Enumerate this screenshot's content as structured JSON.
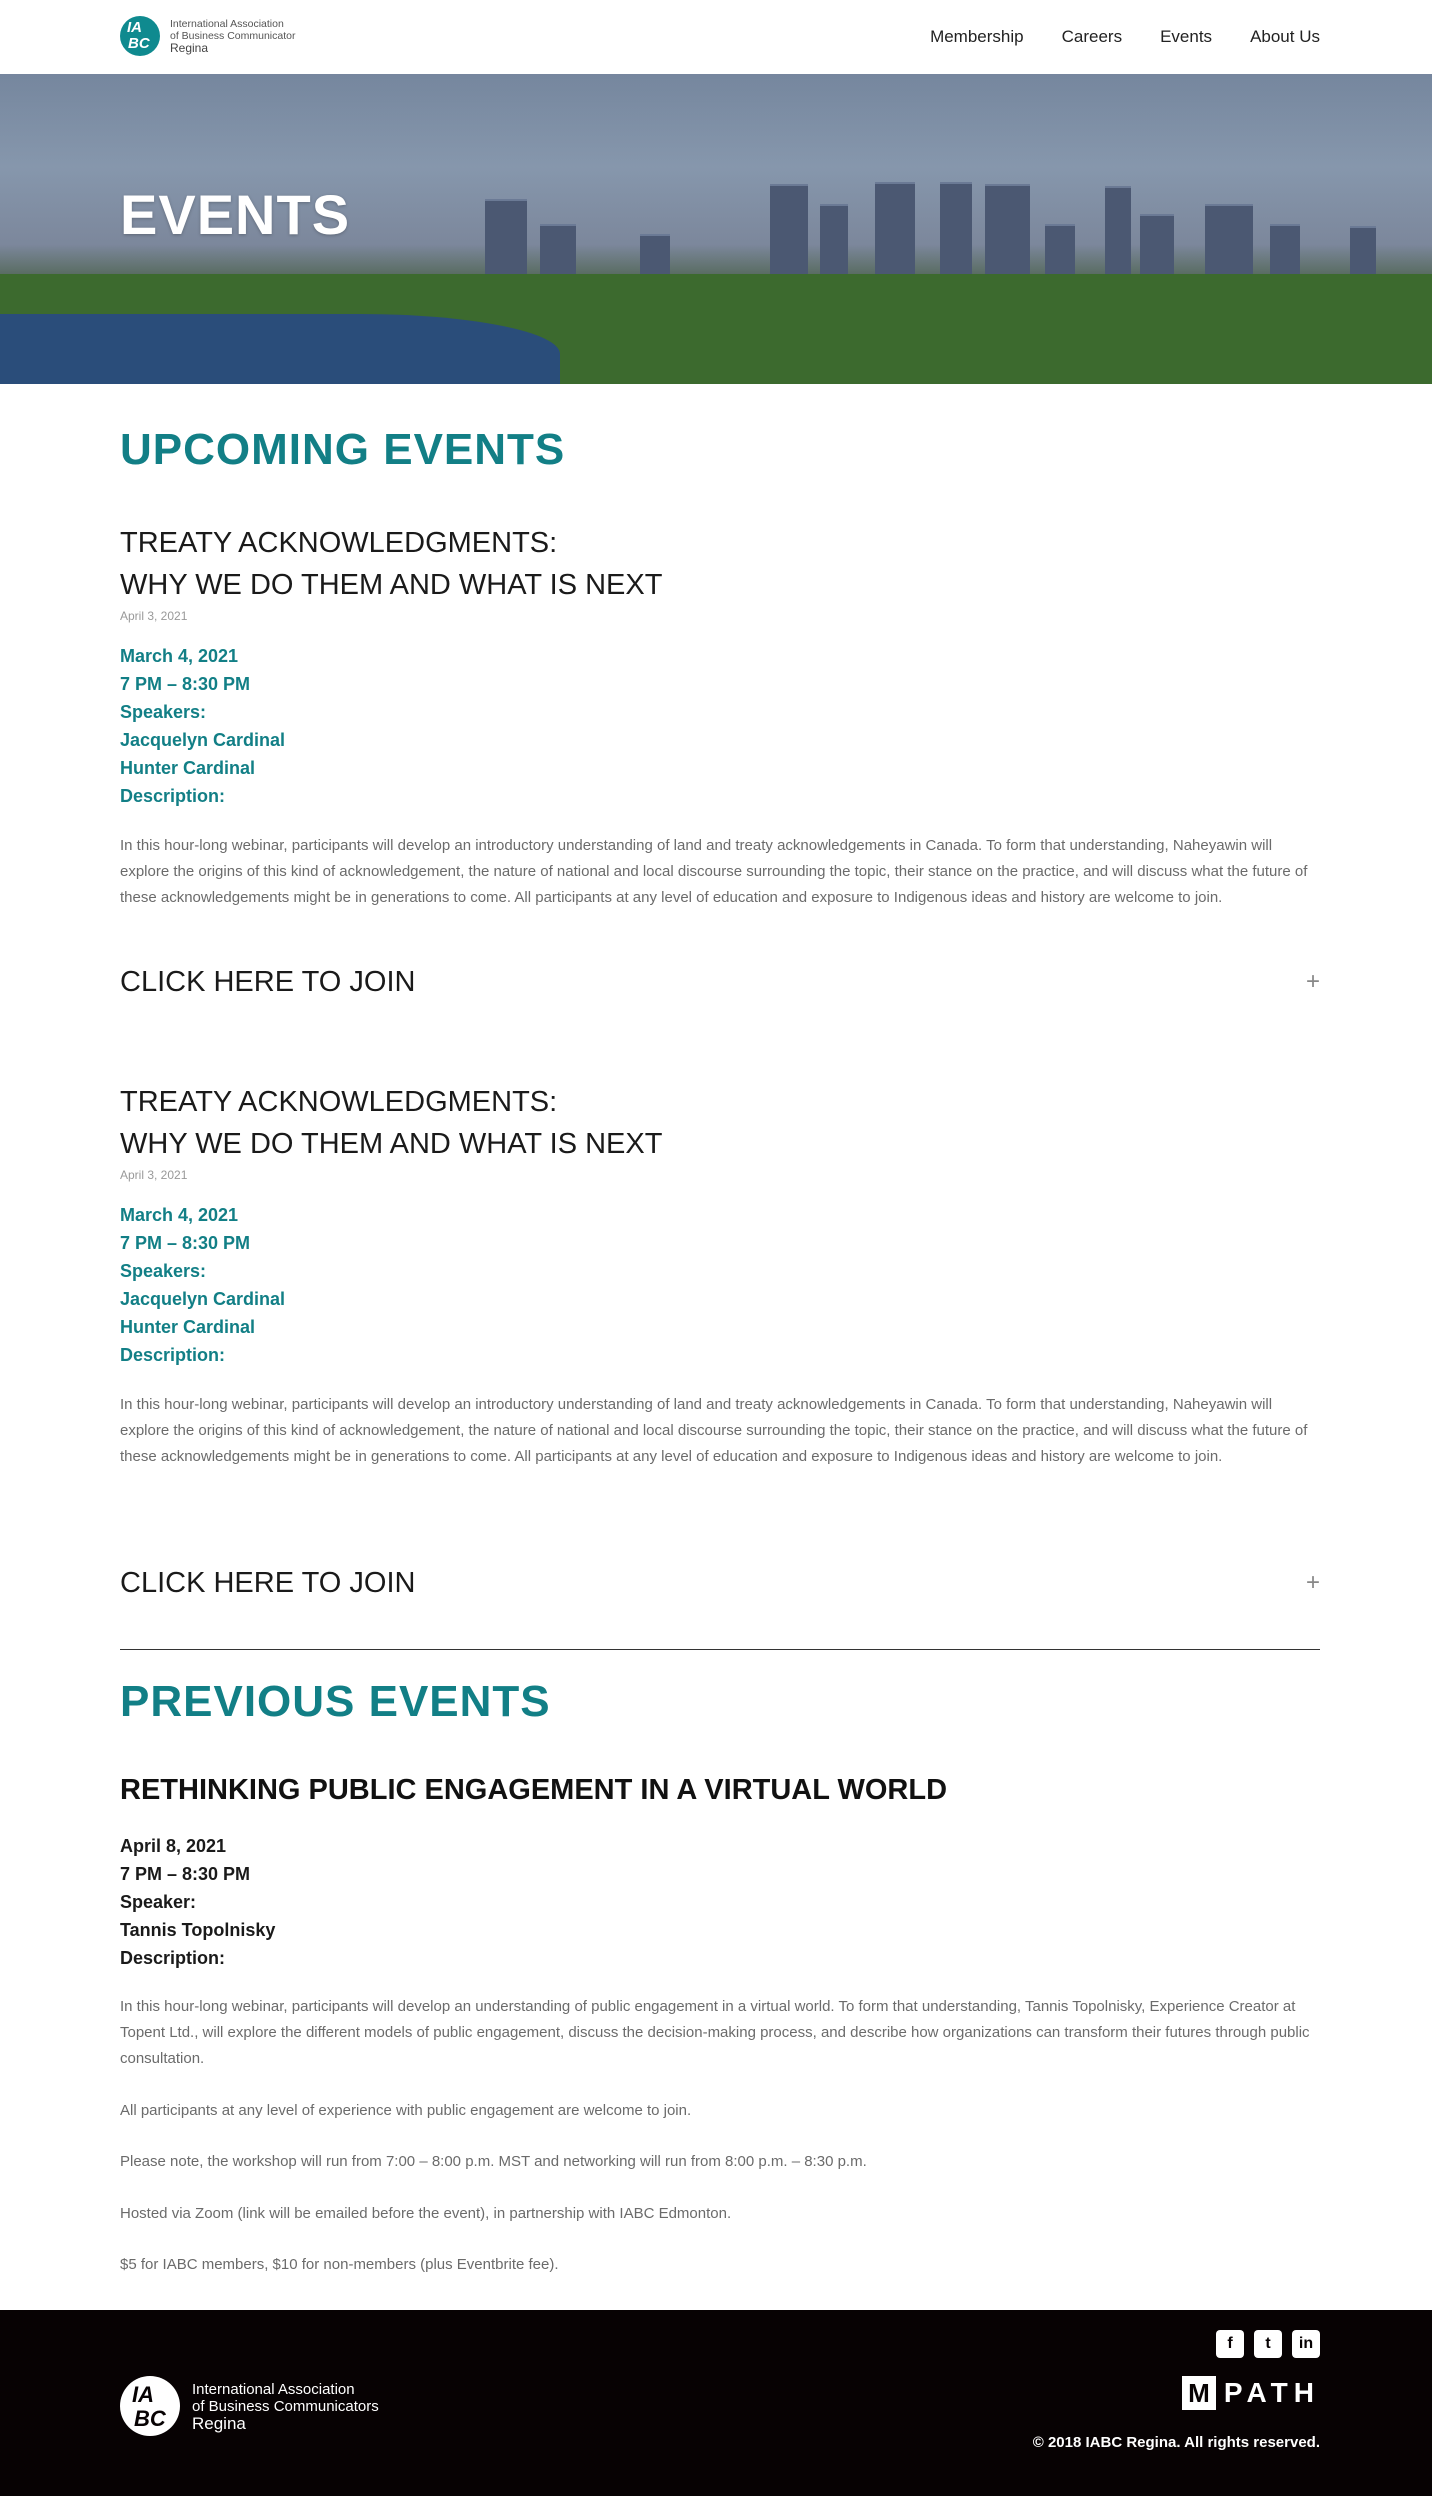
{
  "header": {
    "logo_line1": "International Association",
    "logo_line2": "of Business Communicator",
    "logo_line3": "Regina",
    "nav": [
      "Membership",
      "Careers",
      "Events",
      "About Us"
    ]
  },
  "hero": {
    "title": "EVENTS"
  },
  "upcoming": {
    "section_title": "UPCOMING EVENTS",
    "events": [
      {
        "title_line1": "TREATY ACKNOWLEDGMENTS:",
        "title_line2": "WHY WE DO THEM AND WHAT IS NEXT",
        "post_date": "April 3, 2021",
        "date": "March 4, 2021",
        "time": "7 PM – 8:30 PM",
        "speakers_label": "Speakers:",
        "speaker1": "Jacquelyn Cardinal",
        "speaker2": "Hunter Cardinal",
        "description_label": "Description:",
        "description": "In this hour-long webinar, participants will develop an introductory understanding of land and treaty acknowledgements in Canada. To form that understanding, Naheyawin will explore the origins of this kind of acknowledgement, the nature of national and local discourse surrounding the topic, their stance on the practice, and will discuss what the future of these acknowledgements might be in generations to come. All participants at any level of education and exposure to Indigenous ideas and history are welcome to join.",
        "join_label": "CLICK HERE TO JOIN"
      },
      {
        "title_line1": "TREATY ACKNOWLEDGMENTS:",
        "title_line2": "WHY WE DO THEM AND WHAT IS NEXT",
        "post_date": "April 3, 2021",
        "date": "March 4, 2021",
        "time": "7 PM – 8:30 PM",
        "speakers_label": "Speakers:",
        "speaker1": "Jacquelyn Cardinal",
        "speaker2": "Hunter Cardinal",
        "description_label": "Description:",
        "description": "In this hour-long webinar, participants will develop an introductory understanding of land and treaty acknowledgements in Canada. To form that understanding, Naheyawin will explore the origins of this kind of acknowledgement, the nature of national and local discourse surrounding the topic, their stance on the practice, and will discuss what the future of these acknowledgements might be in generations to come. All participants at any level of education and exposure to Indigenous ideas and history are welcome to join.",
        "join_label": "CLICK HERE TO JOIN"
      }
    ]
  },
  "previous": {
    "section_title": "PREVIOUS EVENTS",
    "event": {
      "title": "RETHINKING PUBLIC ENGAGEMENT IN A VIRTUAL WORLD",
      "date": "April 8, 2021",
      "time": "7 PM – 8:30 PM",
      "speaker_label": "Speaker:",
      "speaker": "Tannis Topolnisky",
      "description_label": "Description:",
      "p1": "In this hour-long webinar, participants will develop an understanding of public engagement in a virtual world. To form that understanding, Tannis Topolnisky, Experience Creator at Topent Ltd., will explore the different models of public engagement, discuss the decision-making process, and describe how organizations can transform their futures through public consultation.",
      "p2": "All participants at any level of experience with public engagement are welcome to join.",
      "p3": "Please note, the workshop will run from 7:00 – 8:00 p.m. MST and networking will run from 8:00 p.m. – 8:30 p.m.",
      "p4": "Hosted via Zoom (link will be emailed before the event), in partnership with IABC Edmonton.",
      "p5": "$5 for IABC members, $10 for non-members (plus Eventbrite fee)."
    }
  },
  "footer": {
    "logo_line1": "International Association",
    "logo_line2": "of Business Communicators",
    "logo_line3": "Regina",
    "social": [
      "facebook-icon",
      "twitter-icon",
      "linkedin-icon"
    ],
    "mpath_m": "M",
    "mpath_text": "PATH",
    "copyright": "© 2018 IABC Regina. All rights reserved."
  },
  "colors": {
    "accent": "#127f86",
    "footer_bg": "#070203"
  }
}
